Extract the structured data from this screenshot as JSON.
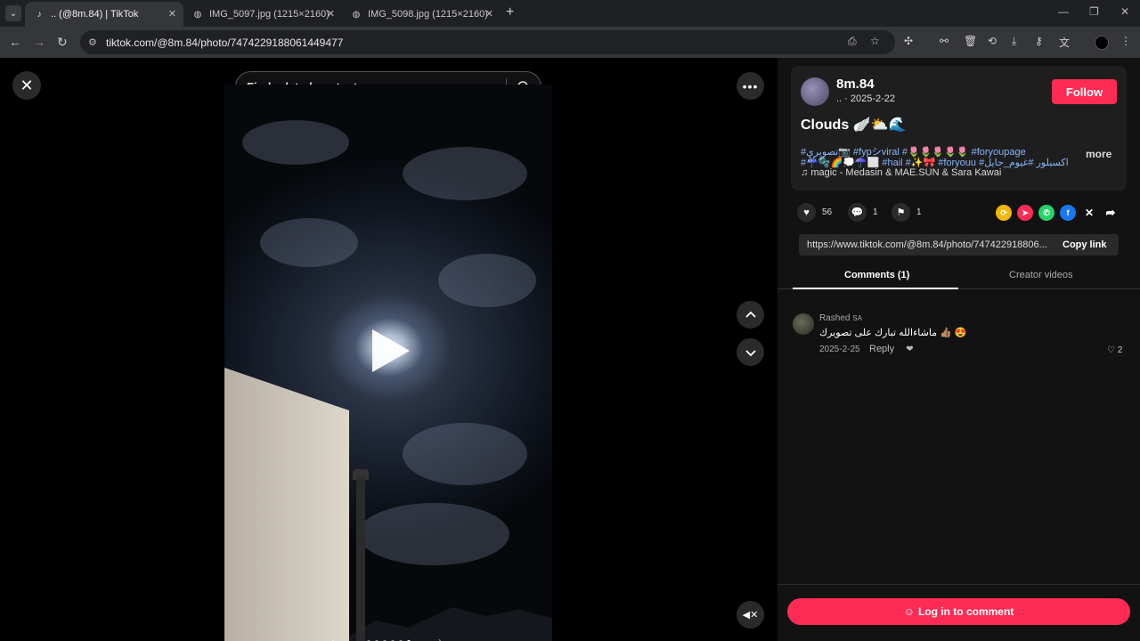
{
  "browser": {
    "tabs": [
      {
        "title": ".. (@8m.84) | TikTok",
        "active": true,
        "icon": "tiktok-icon"
      },
      {
        "title": "IMG_5097.jpg (1215×2160)",
        "active": false,
        "icon": "globe-icon"
      },
      {
        "title": "IMG_5098.jpg (1215×2160)",
        "active": false,
        "icon": "globe-icon"
      }
    ],
    "url": "tiktok.com/@8m.84/photo/7474229188061449477"
  },
  "viewer": {
    "search_placeholder": "Find related content",
    "slide_count": 6,
    "active_slide": 6
  },
  "post": {
    "author": "8m.84",
    "meta": ".. · 2025-2-22",
    "follow_label": "Follow",
    "title": "Clouds 🪽⛅🌊",
    "tags_line1": "#تصويري📷 #fypシviral #🌷🌷🌷🌷🌷 #foryoupage",
    "tags_line2": "#☔🫧🌈💭☂️⬜ #hail #✨🎀 #foryouu #اكسبلور #غيوم_حايل",
    "more_label": "more",
    "music": "magic - Medasin & MAE.SUN & Sara Kawai",
    "likes": "56",
    "comments": "1",
    "saves": "1",
    "link": "https://www.tiktok.com/@8m.84/photo/747422918806...",
    "copy_label": "Copy link"
  },
  "tabs": {
    "comments_label": "Comments (1)",
    "creator_label": "Creator videos"
  },
  "comment": {
    "user": "Rashed",
    "user_badge": "SA",
    "text": "ماشاءالله تبارك على تصويرك 👍🏽 😍",
    "date": "2025-2-25",
    "reply_label": "Reply",
    "likes": "2"
  },
  "login_label": "Log in to comment",
  "colors": {
    "accent": "#fe2c55",
    "link": "#8ab4f8"
  }
}
